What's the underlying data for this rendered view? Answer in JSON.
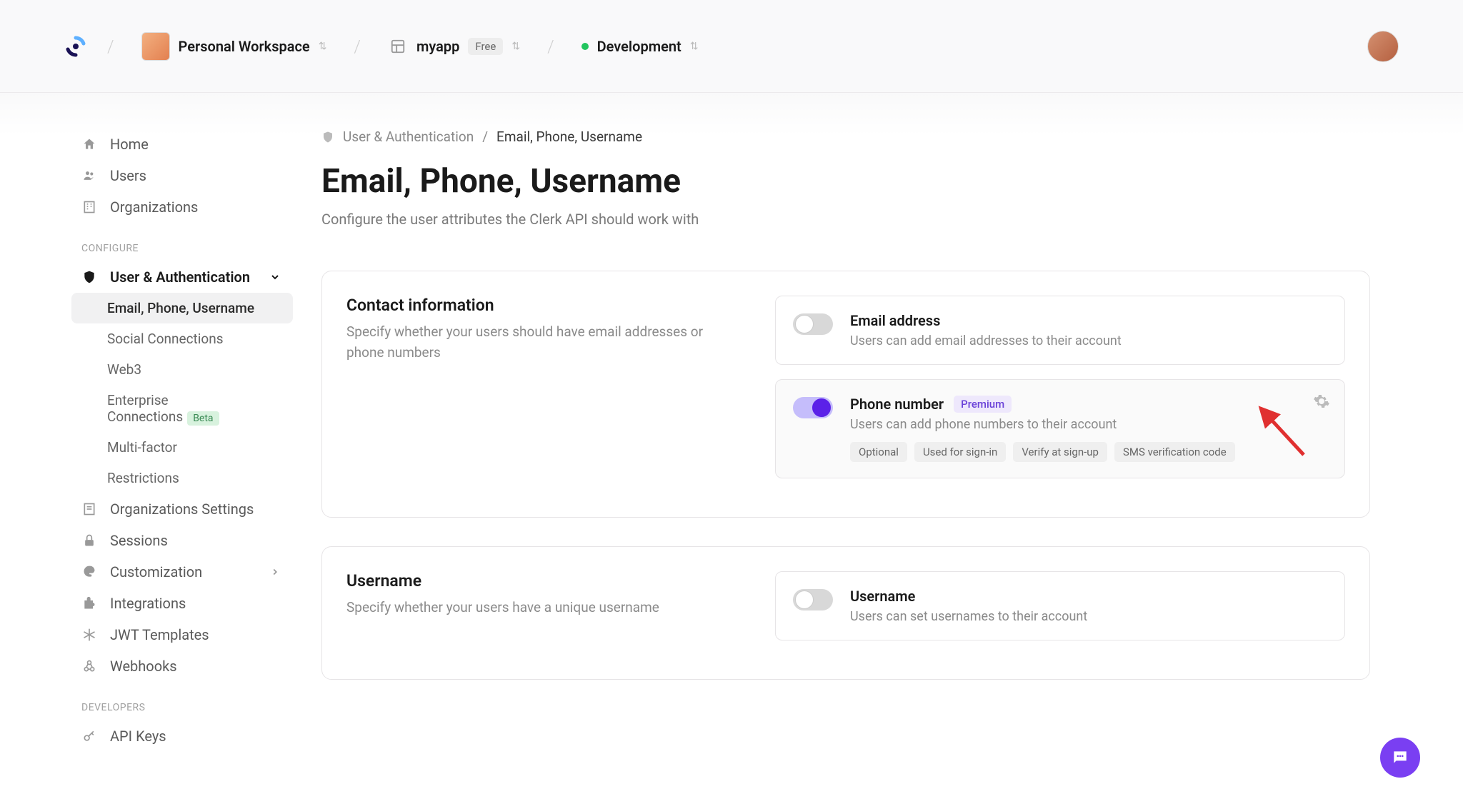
{
  "header": {
    "workspace_label": "Personal Workspace",
    "app_label": "myapp",
    "app_badge": "Free",
    "env_label": "Development"
  },
  "sidebar": {
    "top": [
      {
        "label": "Home",
        "icon": "home"
      },
      {
        "label": "Users",
        "icon": "users"
      },
      {
        "label": "Organizations",
        "icon": "org"
      }
    ],
    "configure_label": "CONFIGURE",
    "auth_label": "User & Authentication",
    "auth_children": [
      {
        "label": "Email, Phone, Username"
      },
      {
        "label": "Social Connections"
      },
      {
        "label": "Web3"
      },
      {
        "label": "Enterprise Connections",
        "beta": "Beta"
      },
      {
        "label": "Multi-factor"
      },
      {
        "label": "Restrictions"
      }
    ],
    "lower": [
      {
        "label": "Organizations Settings",
        "icon": "org"
      },
      {
        "label": "Sessions",
        "icon": "lock"
      },
      {
        "label": "Customization",
        "icon": "paint",
        "chevron": true
      },
      {
        "label": "Integrations",
        "icon": "puzzle"
      },
      {
        "label": "JWT Templates",
        "icon": "snow"
      },
      {
        "label": "Webhooks",
        "icon": "link"
      }
    ],
    "developers_label": "DEVELOPERS",
    "dev_items": [
      {
        "label": "API Keys",
        "icon": "key"
      }
    ]
  },
  "breadcrumb": {
    "parent": "User & Authentication",
    "current": "Email, Phone, Username"
  },
  "page_title": "Email, Phone, Username",
  "page_subtitle": "Configure the user attributes the Clerk API should work with",
  "card_contact": {
    "title": "Contact information",
    "desc": "Specify whether your users should have email addresses or phone numbers",
    "options": [
      {
        "title": "Email address",
        "desc": "Users can add email addresses to their account",
        "on": false
      },
      {
        "title": "Phone number",
        "premium": "Premium",
        "desc": "Users can add phone numbers to their account",
        "on": true,
        "chips": [
          "Optional",
          "Used for sign-in",
          "Verify at sign-up",
          "SMS verification code"
        ]
      }
    ]
  },
  "card_username": {
    "title": "Username",
    "desc": "Specify whether your users have a unique username",
    "options": [
      {
        "title": "Username",
        "desc": "Users can set usernames to their account",
        "on": false
      }
    ]
  }
}
